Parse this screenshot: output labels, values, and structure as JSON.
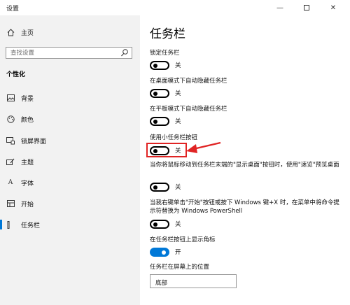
{
  "window": {
    "title": "设置",
    "minimize": "—",
    "close": "✕"
  },
  "sidebar": {
    "home": "主页",
    "search_placeholder": "查找设置",
    "section": "个性化",
    "items": [
      {
        "label": "背景",
        "icon": "image-icon"
      },
      {
        "label": "颜色",
        "icon": "palette-icon"
      },
      {
        "label": "锁屏界面",
        "icon": "lock-screen-icon"
      },
      {
        "label": "主题",
        "icon": "theme-icon"
      },
      {
        "label": "字体",
        "icon": "font-icon"
      },
      {
        "label": "开始",
        "icon": "start-icon"
      },
      {
        "label": "任务栏",
        "icon": "taskbar-icon",
        "selected": true
      }
    ],
    "accent_color": "#0078d7"
  },
  "main": {
    "title": "任务栏",
    "settings": [
      {
        "label": "锁定任务栏",
        "state": "关",
        "on": false
      },
      {
        "label": "在桌面模式下自动隐藏任务栏",
        "state": "关",
        "on": false
      },
      {
        "label": "在平板模式下自动隐藏任务栏",
        "state": "关",
        "on": false
      },
      {
        "label": "使用小任务栏按钮",
        "state": "关",
        "on": false
      },
      {
        "label": "当你将鼠标移动到任务栏末端的\"显示桌面\"按钮时，使用\"速览\"预览桌面",
        "state": "关",
        "on": false
      },
      {
        "label": "当我右键单击\"开始\"按钮或按下 Windows 键+X 时，在菜单中将命令提示符替换为 Windows PowerShell",
        "state": "关",
        "on": false
      },
      {
        "label": "在任务栏按钮上显示角标",
        "state": "开",
        "on": true
      }
    ],
    "position_label": "任务栏在屏幕上的位置",
    "position_value": "底部",
    "annotation_color": "#e02424"
  }
}
